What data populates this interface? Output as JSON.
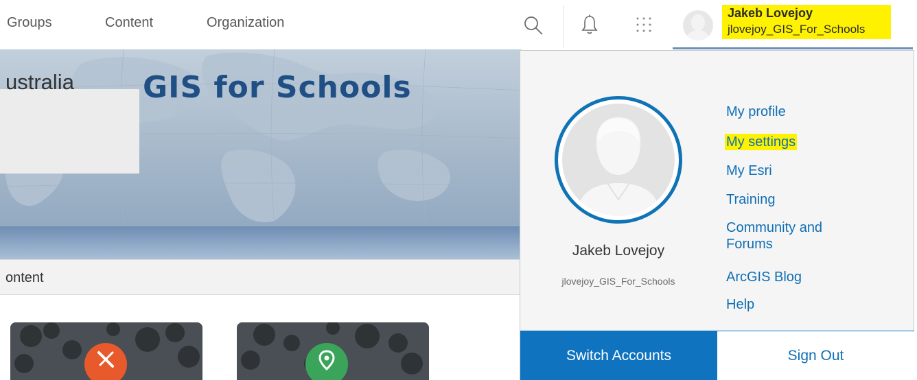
{
  "nav": {
    "groups": "Groups",
    "content": "Content",
    "organization": "Organization",
    "icons": [
      "search-icon",
      "bell-icon",
      "apps-grid-icon"
    ]
  },
  "user": {
    "name": "Jakeb Lovejoy",
    "handle": "jlovejoy_GIS_For_Schools"
  },
  "banner": {
    "org_name": "ustralia",
    "title": "GIS for Schools"
  },
  "content": {
    "heading": "ontent"
  },
  "dropdown": {
    "name": "Jakeb Lovejoy",
    "handle": "jlovejoy_GIS_For_Schools",
    "menu": [
      {
        "label": "My profile"
      },
      {
        "label": "My settings",
        "highlighted": true
      },
      {
        "label": "My Esri"
      },
      {
        "label": "Training"
      },
      {
        "label": "Community and Forums"
      },
      {
        "label": "ArcGIS Blog"
      },
      {
        "label": "Help"
      }
    ],
    "switch_label": "Switch Accounts",
    "signout_label": "Sign Out"
  },
  "colors": {
    "accent": "#0f73bf",
    "link": "#0f6fb4",
    "highlight": "#fff200",
    "title": "#1f4f84"
  }
}
